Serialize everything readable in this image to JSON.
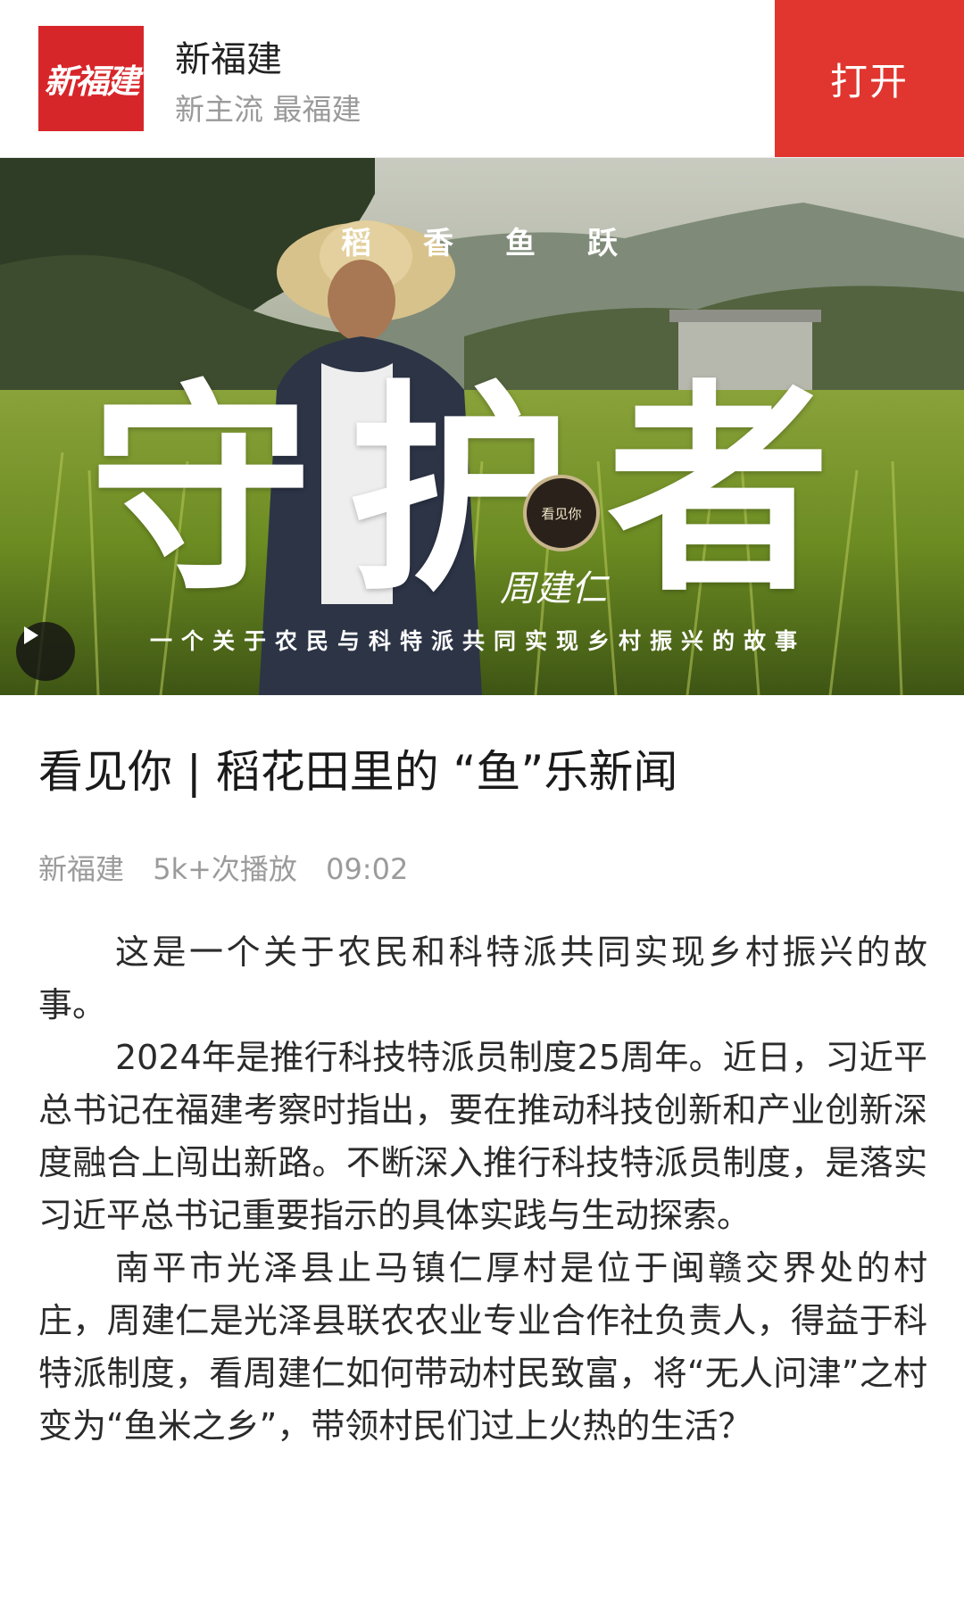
{
  "banner": {
    "logo_text": "新福建",
    "app_name": "新福建",
    "slogan": "新主流 最福建",
    "open_label": "打开"
  },
  "video": {
    "cover_top": "稻香鱼跃",
    "cover_title": "守护者",
    "cover_name": "周建仁",
    "cover_stamp": "看见你",
    "cover_subtitle": "一个关于农民与科特派共同实现乡村振兴的故事",
    "play_icon": "play-icon"
  },
  "article": {
    "headline": "看见你 | 稻花田里的 “鱼”乐新闻",
    "source": "新福建",
    "plays": "5k+次播放",
    "duration": "09:02",
    "paragraphs": [
      "这是一个关于农民和科特派共同实现乡村振兴的故事。",
      "2024年是推行科技特派员制度25周年。近日，习近平总书记在福建考察时指出，要在推动科技创新和产业创新深度融合上闯出新路。不断深入推行科技特派员制度，是落实习近平总书记重要指示的具体实践与生动探索。",
      "南平市光泽县止马镇仁厚村是位于闽赣交界处的村庄，周建仁是光泽县联农农业专业合作社负责人，得益于科特派制度，看周建仁如何带动村民致富，将“无人问津”之村变为“鱼米之乡”，带领村民们过上火热的生活？"
    ]
  },
  "colors": {
    "brand_red": "#d7262a",
    "open_button": "#e0362f",
    "meta_gray": "#9b9b9b"
  }
}
